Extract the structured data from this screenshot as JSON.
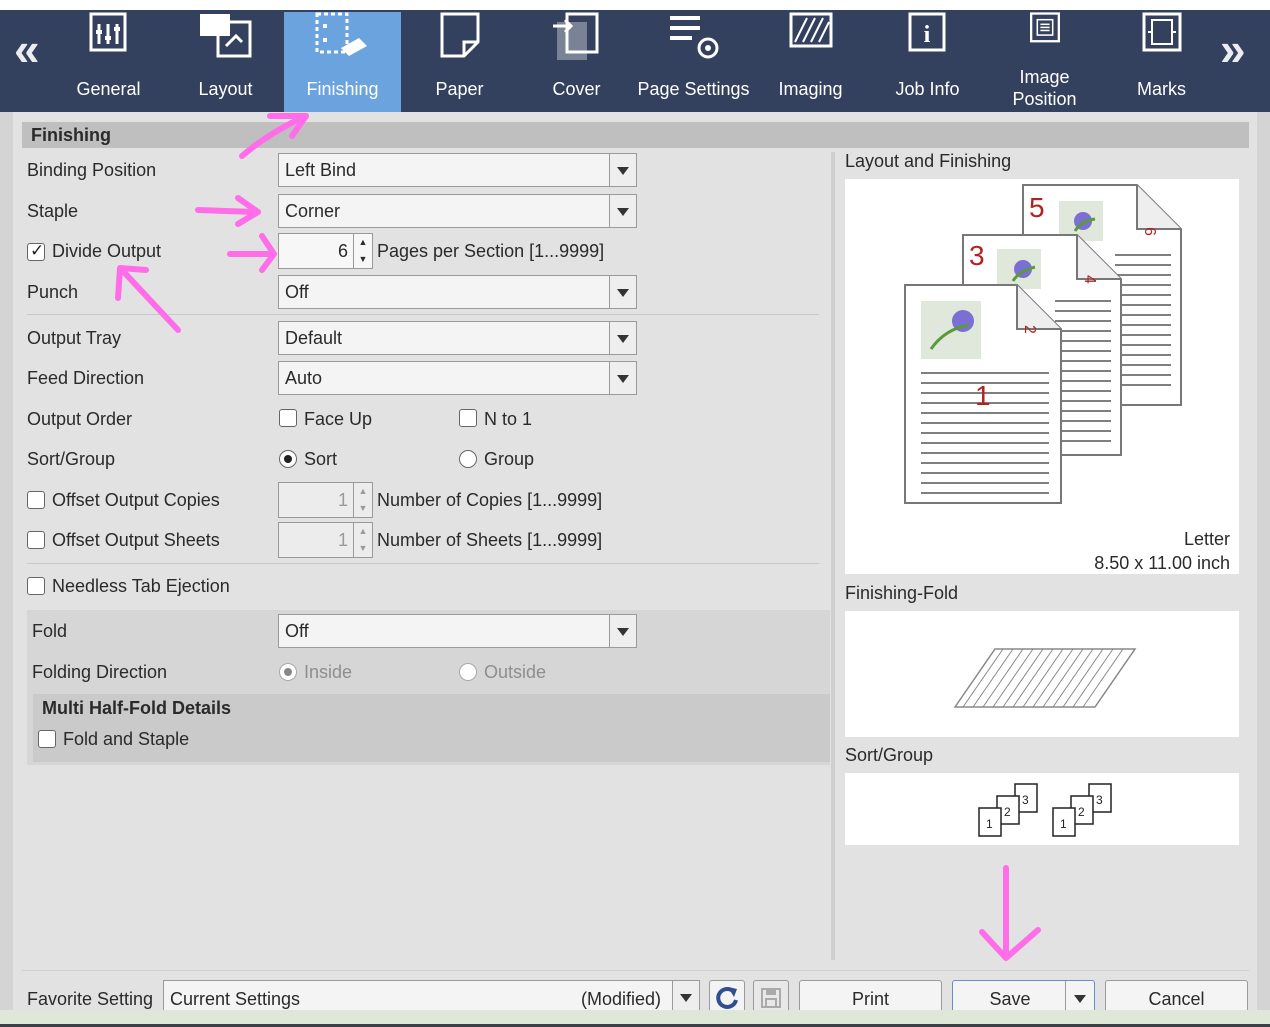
{
  "tabs": [
    {
      "label": "General",
      "icon": "sliders-icon",
      "active": false
    },
    {
      "label": "Layout",
      "icon": "layout-icon",
      "active": false
    },
    {
      "label": "Finishing",
      "icon": "finishing-icon",
      "active": true
    },
    {
      "label": "Paper",
      "icon": "paper-icon",
      "active": false
    },
    {
      "label": "Cover",
      "icon": "cover-icon",
      "active": false
    },
    {
      "label": "Page Settings",
      "icon": "page-settings-icon",
      "active": false
    },
    {
      "label": "Imaging",
      "icon": "imaging-icon",
      "active": false
    },
    {
      "label": "Job Info",
      "icon": "info-icon",
      "active": false
    },
    {
      "label": "Image Position",
      "icon": "image-position-icon",
      "active": false
    },
    {
      "label": "Marks",
      "icon": "marks-icon",
      "active": false
    }
  ],
  "panel_title": "Finishing",
  "fields": {
    "binding_position": {
      "label": "Binding Position",
      "value": "Left Bind"
    },
    "staple": {
      "label": "Staple",
      "value": "Corner"
    },
    "divide_output": {
      "label": "Divide Output",
      "checked": true,
      "value": "6",
      "suffix": "Pages per Section [1...9999]"
    },
    "punch": {
      "label": "Punch",
      "value": "Off"
    },
    "output_tray": {
      "label": "Output Tray",
      "value": "Default"
    },
    "feed_direction": {
      "label": "Feed Direction",
      "value": "Auto"
    },
    "output_order": {
      "label": "Output Order",
      "face_up": "Face Up",
      "n_to_1": "N to 1"
    },
    "sort_group": {
      "label": "Sort/Group",
      "sort": "Sort",
      "group": "Group",
      "selected": "Sort"
    },
    "offset_copies": {
      "label": "Offset Output Copies",
      "value": "1",
      "suffix": "Number of Copies [1...9999]"
    },
    "offset_sheets": {
      "label": "Offset Output Sheets",
      "value": "1",
      "suffix": "Number of Sheets [1...9999]"
    },
    "needless_tab": {
      "label": "Needless Tab Ejection"
    },
    "fold": {
      "label": "Fold",
      "value": "Off"
    },
    "folding_direction": {
      "label": "Folding Direction",
      "inside": "Inside",
      "outside": "Outside"
    },
    "multi_half_fold": {
      "title": "Multi Half-Fold Details",
      "fold_and_staple": "Fold and Staple"
    }
  },
  "preview": {
    "layout_title": "Layout and Finishing",
    "paper_name": "Letter",
    "paper_size": "8.50 x 11.00 inch",
    "page_numbers": [
      "1",
      "2",
      "3",
      "4",
      "5",
      "6"
    ],
    "fold_title": "Finishing-Fold",
    "sort_title": "Sort/Group",
    "sort_sets": [
      [
        "1",
        "2",
        "3"
      ],
      [
        "1",
        "2",
        "3"
      ]
    ]
  },
  "footer": {
    "favorite_label": "Favorite Setting",
    "favorite_value": "Current Settings",
    "favorite_state": "(Modified)",
    "print": "Print",
    "save": "Save",
    "cancel": "Cancel"
  },
  "colors": {
    "toolbar": "#33405e",
    "active_tab": "#6aa3dd",
    "annotation": "#ff6ee8",
    "page_number": "#b22222"
  }
}
